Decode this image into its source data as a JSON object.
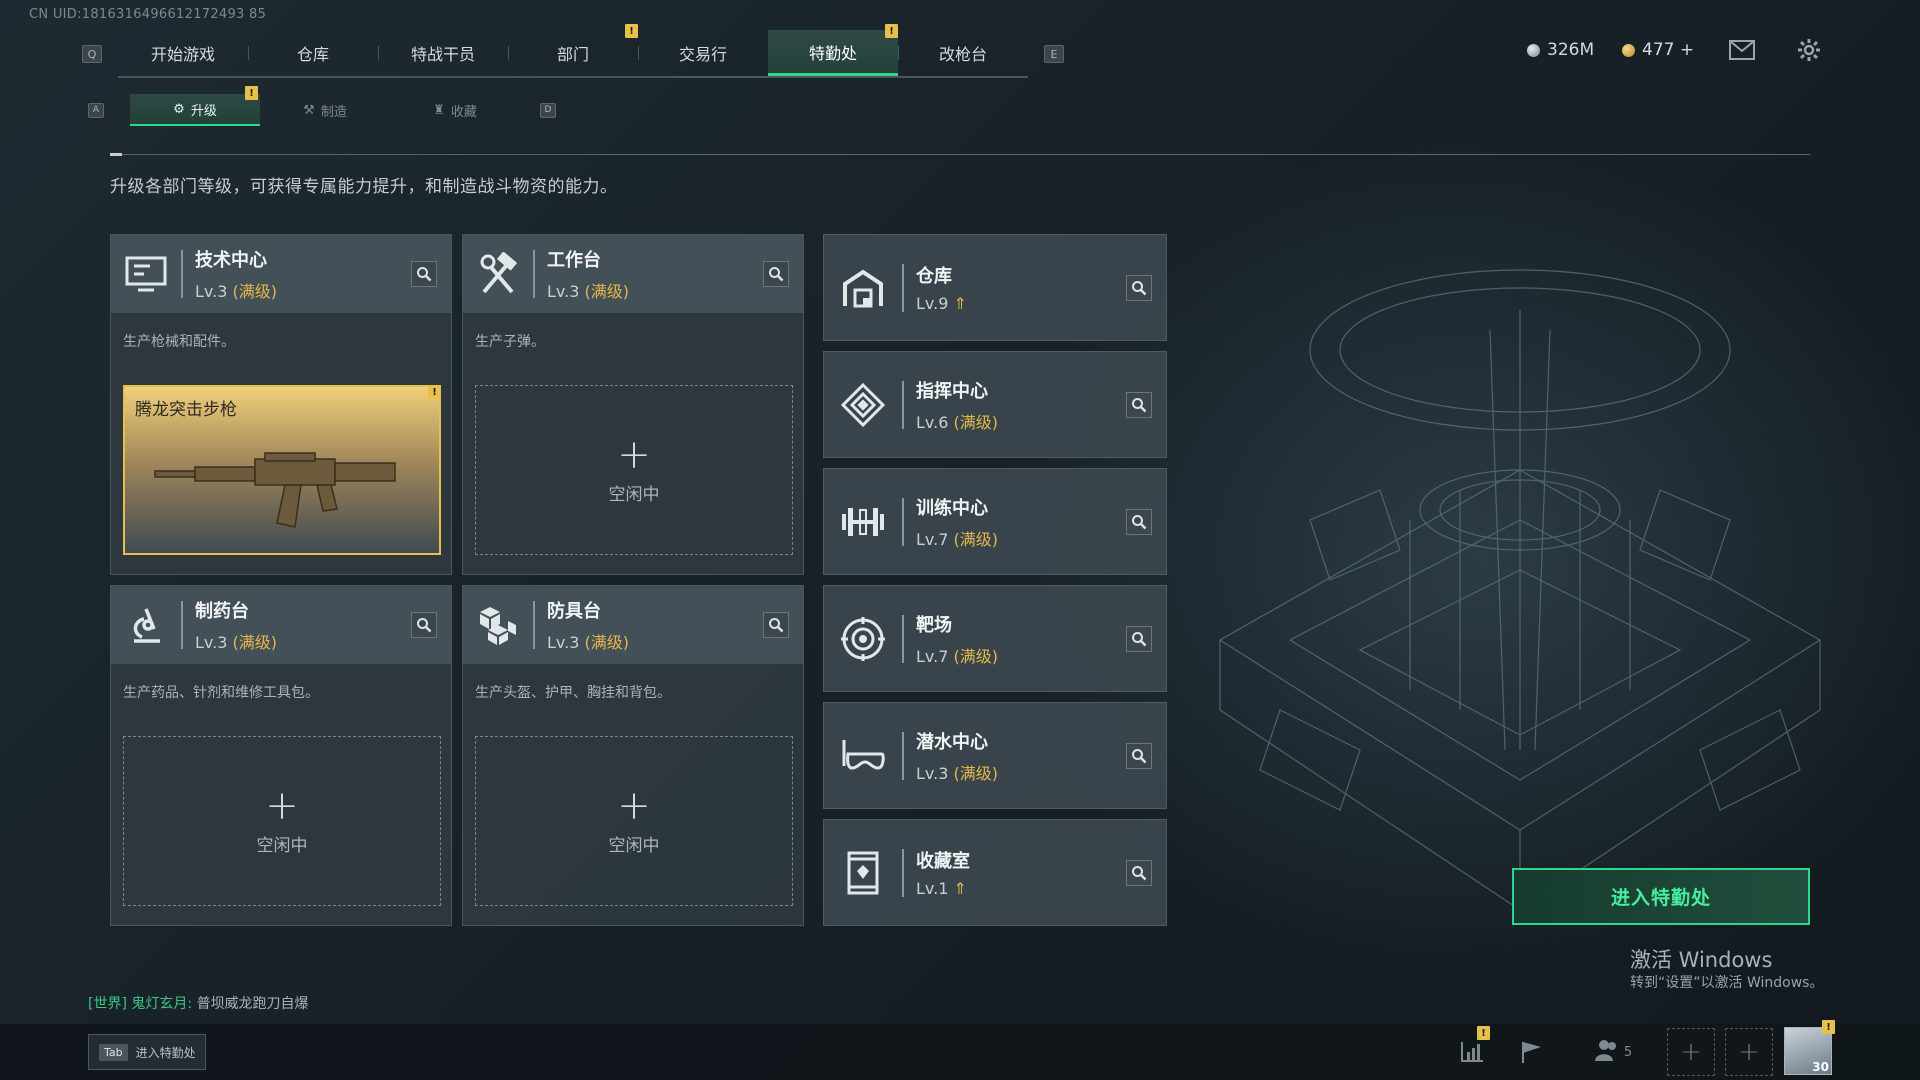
{
  "uid_text": "CN UID:1816316496612172493 85",
  "top_nav": {
    "key_left": "Q",
    "key_right": "E",
    "tabs": [
      {
        "label": "开始游戏",
        "badge": ""
      },
      {
        "label": "仓库",
        "badge": ""
      },
      {
        "label": "特战干员",
        "badge": ""
      },
      {
        "label": "部门",
        "badge": "!"
      },
      {
        "label": "交易行",
        "badge": ""
      },
      {
        "label": "特勤处",
        "badge": "!"
      },
      {
        "label": "改枪台",
        "badge": ""
      }
    ],
    "active_tab": "特勤处"
  },
  "currency": {
    "primary": "326M",
    "secondary": "477 +"
  },
  "sub_nav": {
    "key_left": "A",
    "key_right": "D",
    "tabs": [
      {
        "label": "升级",
        "badge": "!"
      },
      {
        "label": "制造",
        "badge": ""
      },
      {
        "label": "收藏",
        "badge": ""
      }
    ],
    "active_tab": "升级"
  },
  "description": "升级各部门等级，可获得专属能力提升，和制造战斗物资的能力。",
  "production_cards": [
    {
      "name": "技术中心",
      "level": "Lv.3",
      "status": "(满级)",
      "desc": "生产枪械和配件。",
      "icon": "monitor-icon",
      "slot": {
        "type": "item",
        "label": "腾龙突击步枪",
        "badge": "!"
      }
    },
    {
      "name": "工作台",
      "level": "Lv.3",
      "status": "(满级)",
      "desc": "生产子弹。",
      "icon": "hammer-wrench-icon",
      "slot": {
        "type": "empty",
        "plus": "+",
        "label": "空闲中"
      }
    },
    {
      "name": "制药台",
      "level": "Lv.3",
      "status": "(满级)",
      "desc": "生产药品、针剂和维修工具包。",
      "icon": "microscope-icon",
      "slot": {
        "type": "empty",
        "plus": "+",
        "label": "空闲中"
      }
    },
    {
      "name": "防具台",
      "level": "Lv.3",
      "status": "(满级)",
      "desc": "生产头盔、护甲、胸挂和背包。",
      "icon": "armor-cubes-icon",
      "slot": {
        "type": "empty",
        "plus": "+",
        "label": "空闲中"
      }
    }
  ],
  "departments": [
    {
      "name": "仓库",
      "level": "Lv.9",
      "status": "",
      "upgradable": true,
      "icon": "warehouse-icon"
    },
    {
      "name": "指挥中心",
      "level": "Lv.6",
      "status": "(满级)",
      "upgradable": false,
      "icon": "command-diamond-icon"
    },
    {
      "name": "训练中心",
      "level": "Lv.7",
      "status": "(满级)",
      "upgradable": false,
      "icon": "dumbbell-icon"
    },
    {
      "name": "靶场",
      "level": "Lv.7",
      "status": "(满级)",
      "upgradable": false,
      "icon": "target-icon"
    },
    {
      "name": "潜水中心",
      "level": "Lv.3",
      "status": "(满级)",
      "upgradable": false,
      "icon": "diving-mask-icon"
    },
    {
      "name": "收藏室",
      "level": "Lv.1",
      "status": "",
      "upgradable": true,
      "icon": "trophy-icon"
    }
  ],
  "enter_button": "进入特勤处",
  "activation": {
    "title": "激活 Windows",
    "subtitle": "转到“设置”以激活 Windows。"
  },
  "chat": {
    "channel": "[世界]",
    "name": "鬼灯玄月:",
    "message": "普坝威龙跑刀自爆"
  },
  "bottom_bar": {
    "tab_key": "Tab",
    "tab_label": "进入特勤处",
    "friends_count": "5",
    "avatar_level": "30",
    "stats_badge": "!",
    "avatar_badge": "!"
  },
  "colors": {
    "accent": "#2fd68e",
    "badge": "#e6c24a",
    "maxed": "#e2b84a"
  }
}
